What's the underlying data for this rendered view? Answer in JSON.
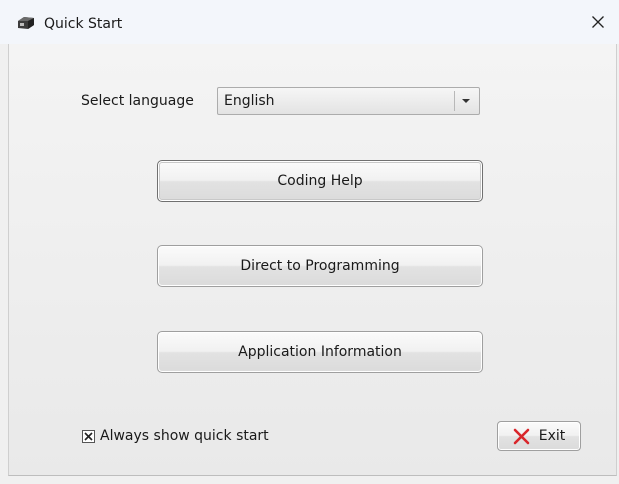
{
  "window": {
    "title": "Quick Start",
    "app_icon": "app-icon",
    "close_icon": "close-icon",
    "close_symbol": "✕"
  },
  "language": {
    "label": "Select language",
    "selected": "English"
  },
  "buttons": {
    "coding_help": "Coding Help",
    "direct_programming": "Direct to Programming",
    "application_info": "Application Information",
    "exit": "Exit"
  },
  "options": {
    "always_show_label": "Always show quick start",
    "always_show_checked": true
  },
  "colors": {
    "exit_icon": "#d9262b"
  }
}
